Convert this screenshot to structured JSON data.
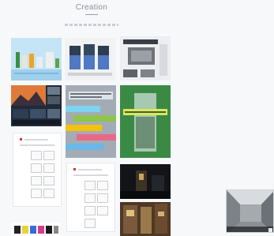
{
  "page": {
    "heading": "Creation"
  },
  "tiles": [
    {
      "name": "tile-bottles-poster",
      "caption": ""
    },
    {
      "name": "tile-kiosk-mockup",
      "caption": ""
    },
    {
      "name": "tile-screen-mockup",
      "caption": ""
    },
    {
      "name": "tile-mountain-slides",
      "caption": ""
    },
    {
      "name": "tile-poster-hands",
      "caption": ""
    },
    {
      "name": "tile-green-poster",
      "caption": ""
    },
    {
      "name": "tile-doc-sheet-1",
      "caption": ""
    },
    {
      "name": "tile-doc-sheet-2",
      "caption": ""
    },
    {
      "name": "tile-night-scene",
      "caption": ""
    },
    {
      "name": "tile-building-scene",
      "caption": ""
    },
    {
      "name": "tile-color-swatches",
      "caption": ""
    }
  ],
  "preview": {
    "caption": ""
  },
  "colors": {
    "background": "#f7f8fa",
    "heading": "#8c8f96",
    "accent_green": "#8fc54a",
    "accent_red": "#d33333"
  }
}
